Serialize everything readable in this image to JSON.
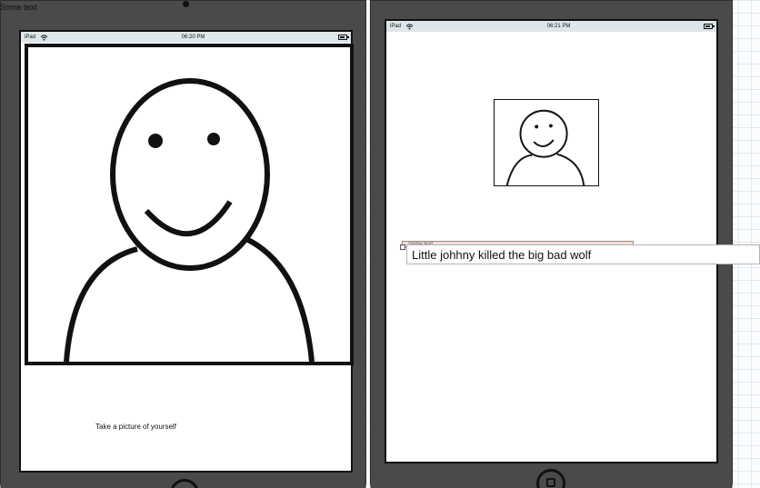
{
  "canvas_label": "Some text",
  "left_device": {
    "status": {
      "carrier": "iPad",
      "time": "06:20 PM"
    },
    "caption": "Take a picture of yourself"
  },
  "right_device": {
    "status": {
      "carrier": "iPad",
      "time": "06:21 PM"
    },
    "tag_label": "Some text"
  },
  "text_field": {
    "value": "Little johhny killed the big bad wolf"
  },
  "colors": {
    "device_frame": "#4a4a4a",
    "status_bar": "#dfe6ea",
    "tag_strip": "#f3dcd6"
  }
}
